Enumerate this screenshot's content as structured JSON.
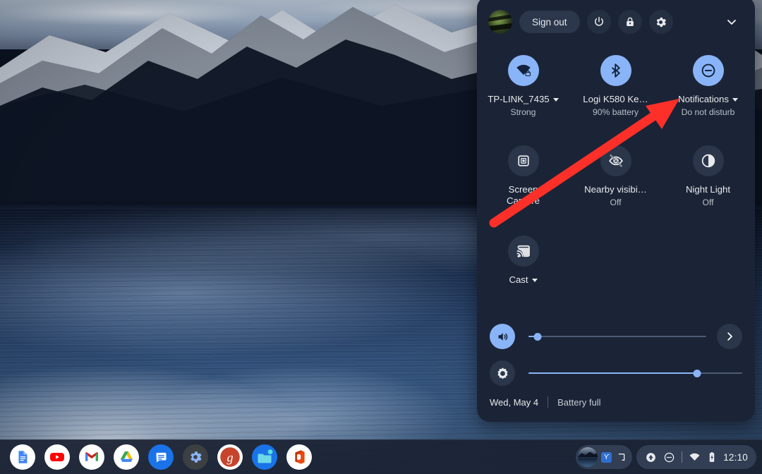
{
  "wallpaper": {
    "name": "mountain-lake-wallpaper"
  },
  "quick_settings": {
    "header": {
      "avatar_name": "user-avatar",
      "sign_out_label": "Sign out",
      "power_label": "power-icon",
      "lock_label": "lock-icon",
      "settings_label": "gear-icon",
      "collapse_label": "chevron-down-icon"
    },
    "tiles": [
      {
        "name": "network",
        "label": "TP-LINK_7435",
        "sub": "Strong",
        "state": "on",
        "caret": true,
        "icon": "wifi-locked-icon"
      },
      {
        "name": "bluetooth",
        "label": "Logi K580 Ke…",
        "sub": "90% battery",
        "state": "on",
        "caret": false,
        "icon": "bluetooth-icon"
      },
      {
        "name": "notifications",
        "label": "Notifications",
        "sub": "Do not disturb",
        "state": "on",
        "caret": true,
        "icon": "do-not-disturb-icon"
      },
      {
        "name": "screen-capture",
        "label": "Screen Capture",
        "sub": "",
        "state": "off",
        "caret": false,
        "icon": "screen-capture-icon"
      },
      {
        "name": "nearby-visibility",
        "label": "Nearby visibi…",
        "sub": "Off",
        "state": "off",
        "caret": false,
        "icon": "eye-slash-icon"
      },
      {
        "name": "night-light",
        "label": "Night Light",
        "sub": "Off",
        "state": "off",
        "caret": false,
        "icon": "night-light-icon"
      },
      {
        "name": "cast",
        "label": "Cast",
        "sub": "",
        "state": "off",
        "caret": true,
        "icon": "cast-icon"
      }
    ],
    "sliders": {
      "volume": {
        "name": "volume-slider",
        "value": 5,
        "icon": "volume-icon",
        "state": "on",
        "next_label": "chevron-right-icon"
      },
      "brightness": {
        "name": "brightness-slider",
        "value": 79,
        "icon": "brightness-icon",
        "state": "off"
      }
    },
    "footer": {
      "date": "Wed, May 4",
      "battery": "Battery full"
    }
  },
  "shelf": {
    "apps": [
      {
        "name": "google-docs",
        "label": "Docs",
        "running": false
      },
      {
        "name": "youtube",
        "label": "YouTube",
        "running": false
      },
      {
        "name": "gmail",
        "label": "Gmail",
        "running": false
      },
      {
        "name": "google-drive",
        "label": "Drive",
        "running": false
      },
      {
        "name": "messages",
        "label": "Messages",
        "running": false
      },
      {
        "name": "settings",
        "label": "Settings",
        "running": true
      },
      {
        "name": "groupon",
        "label": "Groupon",
        "running": true
      },
      {
        "name": "files",
        "label": "Files",
        "running": true
      },
      {
        "name": "office",
        "label": "Office",
        "running": false
      }
    ],
    "tray": {
      "ime_label": "ϒ",
      "update_icon": "update-icon",
      "dnd_icon": "do-not-disturb-icon",
      "wifi_icon": "wifi-icon",
      "battery_icon": "battery-icon",
      "clock": "12:10"
    }
  },
  "annotation": {
    "name": "red-arrow",
    "color": "#fc3028",
    "points_at": "notifications"
  }
}
